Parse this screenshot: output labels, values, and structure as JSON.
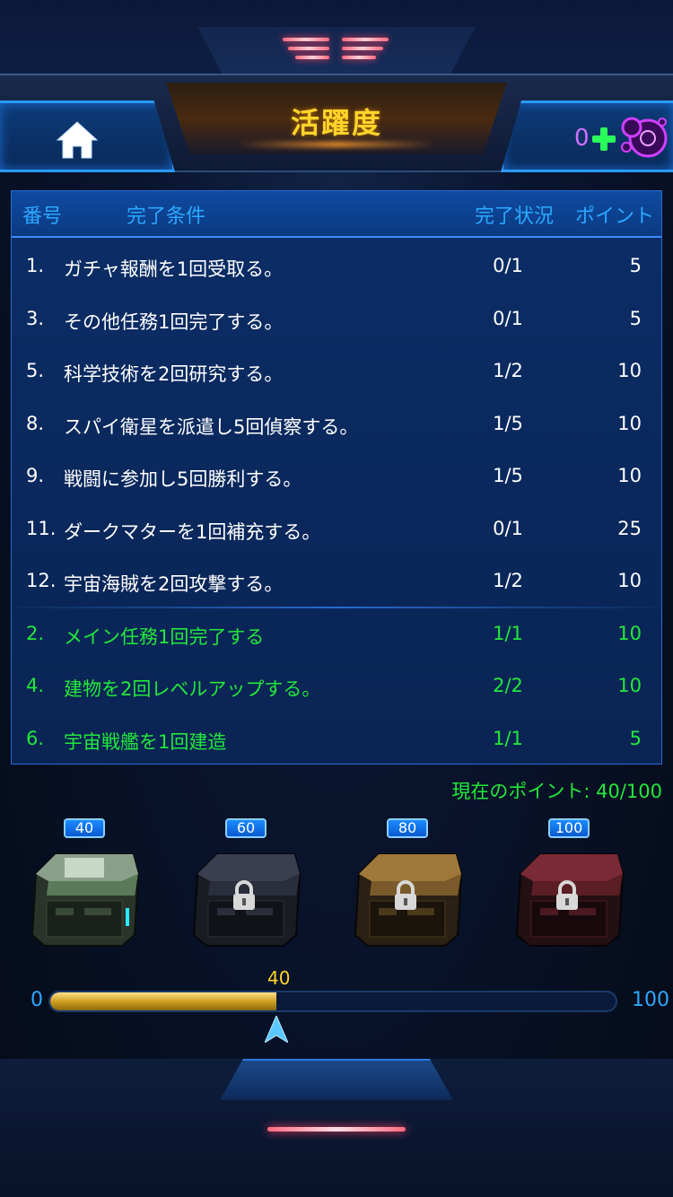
{
  "header": {
    "title": "活躍度",
    "points_count": "0"
  },
  "table": {
    "columns": {
      "no": "番号",
      "condition": "完了条件",
      "status": "完了状況",
      "points": "ポイント"
    },
    "rows": [
      {
        "no": "1.",
        "condition": "ガチャ報酬を1回受取る。",
        "status": "0/1",
        "points": "5",
        "done": false
      },
      {
        "no": "3.",
        "condition": "その他任務1回完了する。",
        "status": "0/1",
        "points": "5",
        "done": false
      },
      {
        "no": "5.",
        "condition": "科学技術を2回研究する。",
        "status": "1/2",
        "points": "10",
        "done": false
      },
      {
        "no": "8.",
        "condition": "スパイ衛星を派遣し5回偵察する。",
        "status": "1/5",
        "points": "10",
        "done": false
      },
      {
        "no": "9.",
        "condition": "戦闘に参加し5回勝利する。",
        "status": "1/5",
        "points": "10",
        "done": false
      },
      {
        "no": "11.",
        "condition": "ダークマターを1回補充する。",
        "status": "0/1",
        "points": "25",
        "done": false
      },
      {
        "no": "12.",
        "condition": "宇宙海賊を2回攻撃する。",
        "status": "1/2",
        "points": "10",
        "done": false
      },
      {
        "no": "2.",
        "condition": "メイン任務1回完了する",
        "status": "1/1",
        "points": "10",
        "done": true
      },
      {
        "no": "4.",
        "condition": "建物を2回レベルアップする。",
        "status": "2/2",
        "points": "10",
        "done": true
      },
      {
        "no": "6.",
        "condition": "宇宙戦艦を1回建造",
        "status": "1/1",
        "points": "5",
        "done": true
      }
    ]
  },
  "current_points": "現在のポイント: 40/100",
  "chests": [
    {
      "threshold": "40",
      "color": "#5a7a5a",
      "locked": false
    },
    {
      "threshold": "60",
      "color": "#2a2e3a",
      "locked": true
    },
    {
      "threshold": "80",
      "color": "#7a5a2a",
      "locked": true
    },
    {
      "threshold": "100",
      "color": "#5a1e24",
      "locked": true
    }
  ],
  "progress": {
    "min_label": "0",
    "max_label": "100",
    "current_label": "40",
    "value": 40,
    "max": 100
  },
  "colors": {
    "title": "#ffd42a",
    "header_text": "#2aa8ff",
    "done": "#22e83a",
    "pending": "#ffffff"
  }
}
